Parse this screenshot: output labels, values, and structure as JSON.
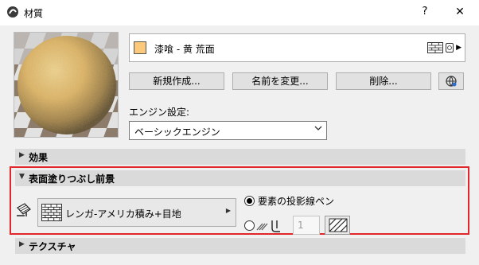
{
  "window": {
    "title": "材質",
    "help_label": "?",
    "close_label": "✕"
  },
  "material": {
    "name": "漆喰 - 黄 荒面",
    "swatch_color": "#fcc97c"
  },
  "buttons": {
    "new": "新規作成...",
    "rename": "名前を変更...",
    "delete": "削除..."
  },
  "engine": {
    "label": "エンジン設定:",
    "value": "ベーシックエンジン"
  },
  "sections": {
    "effect": "効果",
    "surface_fill": "表面塗りつぶし前景",
    "texture": "テクスチャ"
  },
  "surface_fill": {
    "pattern_name": "レンガ-アメリカ積み+目地",
    "option_projection_pen": "要素の投影線ペン",
    "pen_number": "1",
    "projection_selected": true
  },
  "colors": {
    "highlight": "#e1262a",
    "section_bar": "#dadada"
  },
  "icons": [
    "app-icon",
    "help-icon",
    "close-icon",
    "material-swatch-icon",
    "brick-pattern-icon",
    "sphere-preview-icon",
    "globe-icon",
    "chevron-down-icon",
    "triangle-right-icon",
    "triangle-down-icon",
    "paint-bucket-icon",
    "pen-icon",
    "pen-color-swatch-icon"
  ]
}
